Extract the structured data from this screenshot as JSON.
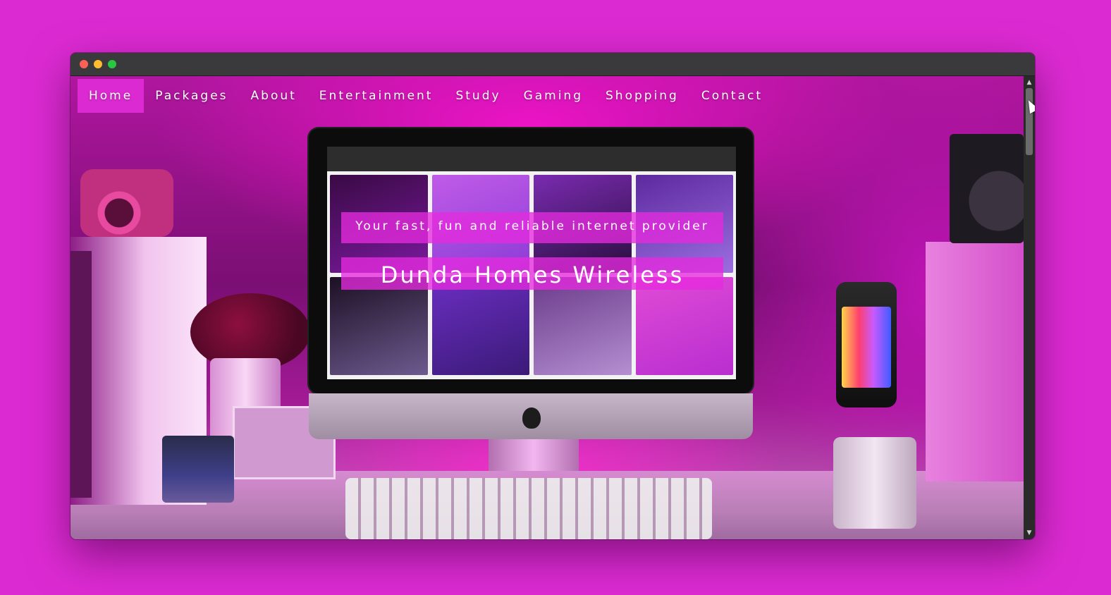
{
  "nav": {
    "items": [
      {
        "label": "Home",
        "active": true
      },
      {
        "label": "Packages"
      },
      {
        "label": "About"
      },
      {
        "label": "Entertainment"
      },
      {
        "label": "Study"
      },
      {
        "label": "Gaming"
      },
      {
        "label": "Shopping"
      },
      {
        "label": "Contact"
      }
    ]
  },
  "hero": {
    "tagline": "Your fast, fun and reliable internet provider",
    "title": "Dunda Homes Wireless"
  },
  "colors": {
    "accent": "#dc2ad2",
    "window_chrome": "#3a3a3c",
    "text": "#ffffff"
  },
  "icons": [
    "close-dot",
    "minimize-dot",
    "zoom-dot",
    "scroll-up-arrow",
    "scroll-down-arrow",
    "mouse-cursor-icon"
  ]
}
